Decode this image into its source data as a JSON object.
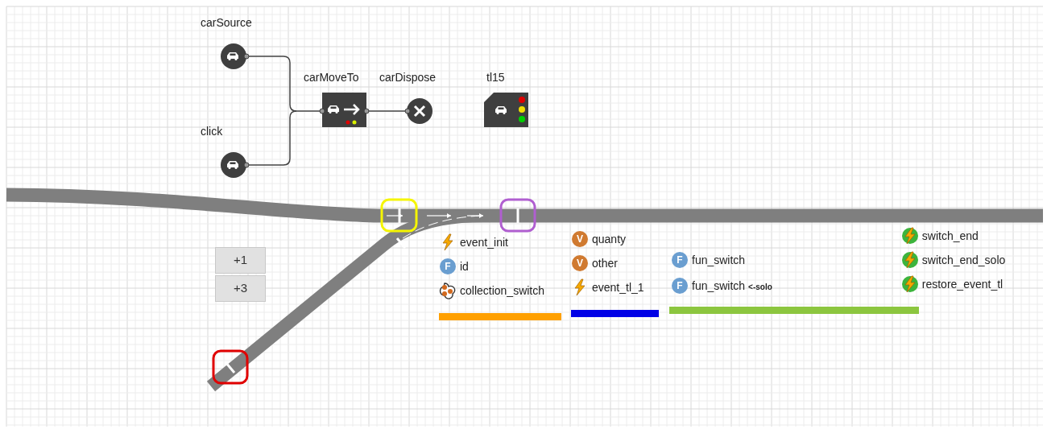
{
  "blocks": [
    {
      "kind": "source",
      "label": "carSource"
    },
    {
      "kind": "source",
      "label": "click"
    },
    {
      "kind": "moveto",
      "label": "carMoveTo"
    },
    {
      "kind": "dispose",
      "label": "carDispose"
    },
    {
      "kind": "trafficlight",
      "label": "tl15"
    }
  ],
  "stop_lines": [
    {
      "color": "#f5f500"
    },
    {
      "color": "#b05fd0"
    },
    {
      "color": "#e00000"
    }
  ],
  "buttons": [
    "+1",
    "+3"
  ],
  "groups": [
    {
      "color": "#ffa000",
      "columns": [
        [
          {
            "kind": "event",
            "label": "event_init"
          },
          {
            "kind": "function",
            "icon_letter": "F",
            "label": "id"
          },
          {
            "kind": "collection",
            "label": "collection_switch"
          }
        ]
      ]
    },
    {
      "color": "#0000e6",
      "columns": [
        [
          {
            "kind": "variable",
            "icon_letter": "V",
            "label": "quanty"
          },
          {
            "kind": "variable",
            "icon_letter": "V",
            "label": "other"
          },
          {
            "kind": "event",
            "label": "event_tl_1"
          }
        ]
      ]
    },
    {
      "color": "#8cc63f",
      "columns": [
        [
          {
            "kind": "function",
            "icon_letter": "F",
            "label": "fun_switch"
          },
          {
            "kind": "function",
            "icon_letter": "F",
            "label": "fun_switch **<-solo**"
          }
        ],
        [
          {
            "kind": "cyclic_event",
            "label": "switch_end"
          },
          {
            "kind": "cyclic_event",
            "label": "switch_end_solo"
          },
          {
            "kind": "cyclic_event",
            "label": "restore_event_tl"
          }
        ]
      ]
    }
  ]
}
